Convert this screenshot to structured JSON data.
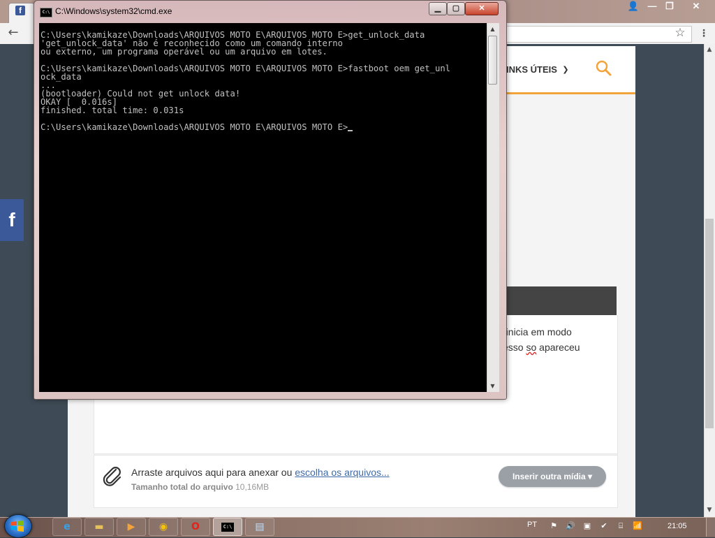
{
  "cmd": {
    "title": "C:\\Windows\\system32\\cmd.exe",
    "icon_label": "C:\\",
    "controls": {
      "minimize": "▁",
      "maximize": "▢",
      "close": "✕"
    },
    "lines": [
      "C:\\Users\\kamikaze\\Downloads\\ARQUIVOS MOTO E\\ARQUIVOS MOTO E>get_unlock_data",
      "'get_unlock_data' não é reconhecido como um comando interno",
      "ou externo, um programa operável ou um arquivo em lotes.",
      "",
      "C:\\Users\\kamikaze\\Downloads\\ARQUIVOS MOTO E\\ARQUIVOS MOTO E>fastboot oem get_unl",
      "ock_data",
      "...",
      "(bootloader) Could not get unlock data!",
      "OKAY [  0.016s]",
      "finished. total time: 0.031s",
      "",
      "C:\\Users\\kamikaze\\Downloads\\ARQUIVOS MOTO E\\ARQUIVOS MOTO E>"
    ]
  },
  "chrome": {
    "tab_favicon": "f",
    "window_controls": {
      "user": "👤",
      "minimize": "—",
      "maximize": "❐",
      "close": "✕"
    }
  },
  "site": {
    "nav_links_uteis": "INKS ÚTEIS",
    "content_line_1": "o inicia em modo",
    "content_line_2_pre": "cesso ",
    "content_line_2_squiggle": "so",
    "content_line_2_post": " apareceu",
    "attach_text": "Arraste arquivos aqui para anexar ou ",
    "attach_link": "escolha os arquivos...",
    "attach_size_label": "Tamanho total do arquivo",
    "attach_size_value": " 10,16MB",
    "insert_media_label": "Inserir outra mídia ▾",
    "facebook_share": "f"
  },
  "taskbar": {
    "language": "PT",
    "clock": "21:05"
  },
  "colors": {
    "accent_orange": "#f2a33a",
    "facebook_blue": "#3b5998",
    "console_text": "#c0c0c0",
    "link_blue": "#3e6aa8"
  }
}
